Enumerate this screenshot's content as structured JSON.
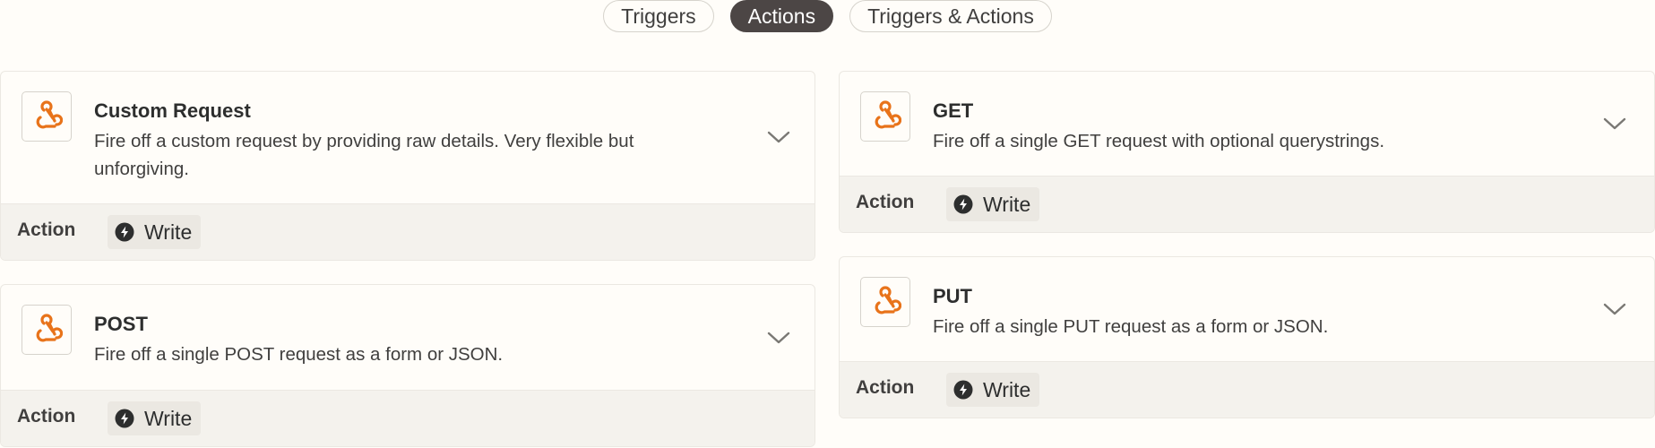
{
  "tabs": [
    {
      "label": "Triggers"
    },
    {
      "label": "Actions"
    },
    {
      "label": "Triggers & Actions"
    }
  ],
  "cards": [
    {
      "title": "Custom Request",
      "description": "Fire off a custom request by providing raw details. Very flexible but unforgiving.",
      "type_label": "Action",
      "badge": "Write"
    },
    {
      "title": "POST",
      "description": "Fire off a single POST request as a form or JSON.",
      "type_label": "Action",
      "badge": "Write"
    },
    {
      "title": "GET",
      "description": "Fire off a single GET request with optional querystrings.",
      "type_label": "Action",
      "badge": "Write"
    },
    {
      "title": "PUT",
      "description": "Fire off a single PUT request as a form or JSON.",
      "type_label": "Action",
      "badge": "Write"
    }
  ],
  "icons": {
    "webhook": "webhook-icon",
    "expand": "chevron-down-icon",
    "bolt": "bolt-icon"
  },
  "colors": {
    "accent": "#e8731a",
    "active_tab": "#4c4645"
  }
}
